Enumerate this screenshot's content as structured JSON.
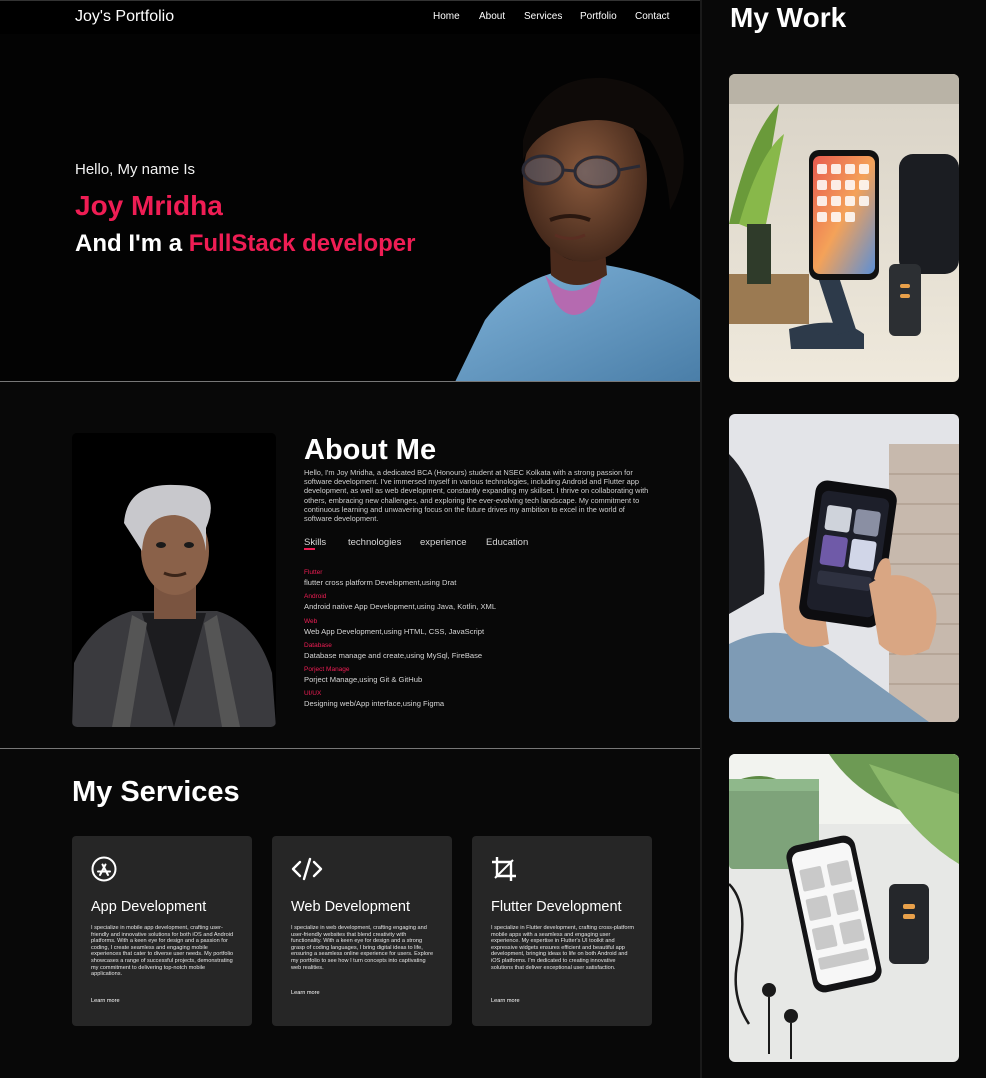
{
  "header": {
    "logo": "Joy's Portfolio",
    "nav": [
      "Home",
      "About",
      "Services",
      "Portfolio",
      "Contact"
    ]
  },
  "hero": {
    "greeting": "Hello, My name Is",
    "name": "Joy Mridha",
    "role_prefix": "And I'm a ",
    "role": "FullStack developer"
  },
  "about": {
    "title": "About Me",
    "text": "Hello, I'm Joy Mridha, a dedicated BCA (Honours) student at NSEC Kolkata with a strong passion for software development. I've immersed myself in various technologies, including Android and Flutter app development, as well as web development, constantly expanding my skillset. I thrive on collaborating with others, embracing new challenges, and exploring the ever-evolving tech landscape. My commitment to continuous learning and unwavering focus on the future drives my ambition to excel in the world of software development.",
    "tabs": [
      "Skills",
      "technologies",
      "experience",
      "Education"
    ],
    "skills": [
      {
        "name": "Flutter",
        "desc": "flutter cross platform Development,using Drat"
      },
      {
        "name": "Android",
        "desc": "Android native App Development,using Java, Kotlin, XML"
      },
      {
        "name": "Web",
        "desc": "Web App Development,using HTML, CSS, JavaScript"
      },
      {
        "name": "Database",
        "desc": "Database manage and create,using MySql, FireBase"
      },
      {
        "name": "Porject Manage",
        "desc": "Porject Manage,using Git & GitHub"
      },
      {
        "name": "UI/UX",
        "desc": "Designing web/App interface,using Figma"
      }
    ]
  },
  "services": {
    "title": "My Services",
    "cards": [
      {
        "title": "App Development",
        "icon": "app-store-icon",
        "text": "I specialize in mobile app development, crafting user-friendly and innovative solutions for both iOS and Android platforms. With a keen eye for design and a passion for coding, I create seamless and engaging mobile experiences that cater to diverse user needs. My portfolio showcases a range of successful projects, demonstrating my commitment to delivering top-notch mobile applications.",
        "link": "Learn more"
      },
      {
        "title": "Web Development",
        "icon": "code-icon",
        "text": "I specialize in web development, crafting engaging and user-friendly websites that blend creativity with functionality. With a keen eye for design and a strong grasp of coding languages, I bring digital ideas to life, ensuring a seamless online experience for users. Explore my portfolio to see how I turn concepts into captivating web realities.",
        "link": "Learn more"
      },
      {
        "title": "Flutter Development",
        "icon": "crop-icon",
        "text": "I specialize in Flutter development, crafting cross-platform mobile apps with a seamless and engaging user experience. My expertise in Flutter's UI toolkit and expressive widgets ensures efficient and beautiful app development, bringing ideas to life on both Android and iOS platforms. I'm dedicated to creating innovative solutions that deliver exceptional user satisfaction.",
        "link": "Learn more"
      }
    ]
  },
  "work": {
    "title": "My Work"
  },
  "colors": {
    "accent": "#ef1d54",
    "background": "#000000",
    "card": "#262626"
  }
}
